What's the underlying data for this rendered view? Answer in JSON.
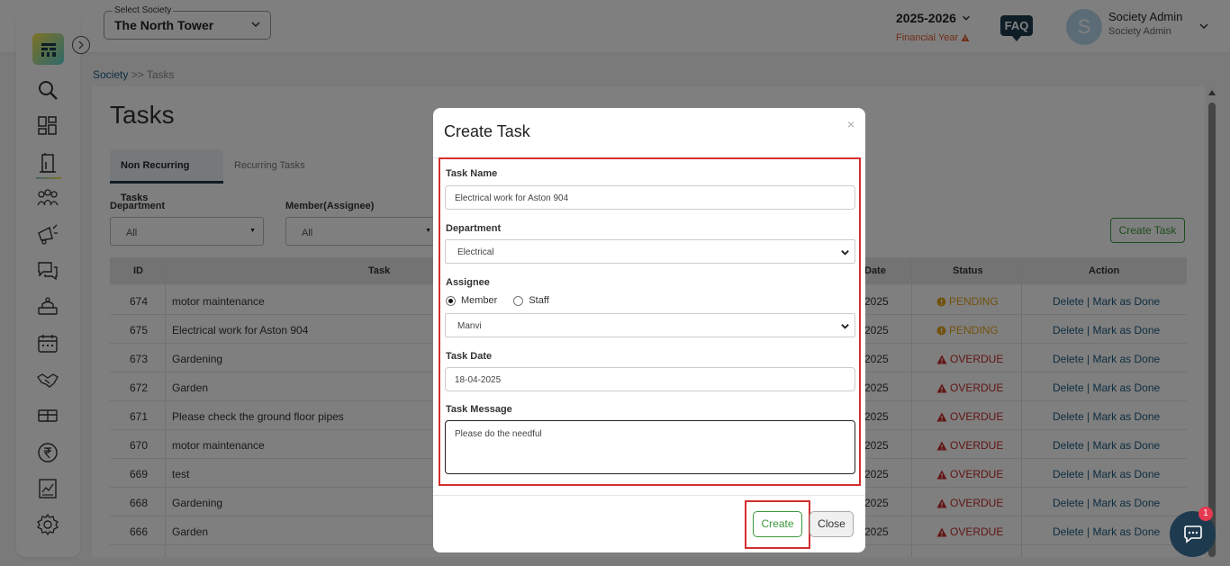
{
  "header": {
    "society_select_label": "Select Society",
    "society_select_value": "The North Tower",
    "financial_year": "2025-2026",
    "financial_year_label": "Financial Year",
    "faq_label": "FAQ",
    "avatar_letter": "S",
    "user_name": "Society Admin",
    "user_role": "Society Admin"
  },
  "breadcrumb": {
    "root": "Society",
    "separator": ">>",
    "current": "Tasks"
  },
  "page": {
    "title": "Tasks",
    "tabs": [
      {
        "label": "Non Recurring Tasks",
        "active": true
      },
      {
        "label": "Recurring Tasks",
        "active": false
      }
    ],
    "filters": {
      "department_label": "Department",
      "department_value": "All",
      "member_label": "Member(Assignee)",
      "member_value": "All"
    },
    "create_task_button": "Create Task",
    "columns": {
      "id": "ID",
      "task": "Task",
      "date": "Date",
      "status": "Status",
      "action": "Action"
    },
    "rows": [
      {
        "id": "674",
        "task": "motor maintenance",
        "date": "2025",
        "status": "PENDING",
        "action": "Delete | Mark as Done"
      },
      {
        "id": "675",
        "task": "Electrical work for Aston 904",
        "date": "2025",
        "status": "PENDING",
        "action": "Delete | Mark as Done"
      },
      {
        "id": "673",
        "task": "Gardening",
        "date": "2025",
        "status": "OVERDUE",
        "action": "Delete | Mark as Done"
      },
      {
        "id": "672",
        "task": "Garden",
        "date": "2025",
        "status": "OVERDUE",
        "action": "Delete | Mark as Done"
      },
      {
        "id": "671",
        "task": "Please check the ground floor pipes",
        "date": "2025",
        "status": "OVERDUE",
        "action": "Delete | Mark as Done"
      },
      {
        "id": "670",
        "task": "motor maintenance",
        "date": "2025",
        "status": "OVERDUE",
        "action": "Delete | Mark as Done"
      },
      {
        "id": "669",
        "task": "test",
        "date": "2025",
        "status": "OVERDUE",
        "action": "Delete | Mark as Done"
      },
      {
        "id": "668",
        "task": "Gardening",
        "date": "2025",
        "status": "OVERDUE",
        "action": "Delete | Mark as Done"
      },
      {
        "id": "666",
        "task": "Garden",
        "date": "2025",
        "status": "OVERDUE",
        "action": "Delete | Mark as Done"
      }
    ]
  },
  "modal": {
    "title": "Create Task",
    "close_symbol": "×",
    "task_name_label": "Task Name",
    "task_name_value": "Electrical work for Aston 904",
    "department_label": "Department",
    "department_value": "Electrical",
    "assignee_label": "Assignee",
    "assignee_option_member": "Member",
    "assignee_option_staff": "Staff",
    "assignee_value": "Manvi",
    "task_date_label": "Task Date",
    "task_date_value": "18-04-2025",
    "task_message_label": "Task Message",
    "task_message_value": "Please do the needful",
    "create_button": "Create",
    "close_button": "Close"
  },
  "chat": {
    "badge_count": "1"
  },
  "colors": {
    "accent_navy": "#1e3a4f",
    "pending": "#e3a51a",
    "overdue": "#c62828",
    "link": "#1c5a80",
    "success_green": "#3a9a3a",
    "highlight_red": "#d32f2f"
  },
  "sidebar_icons": [
    "search-icon",
    "dashboard-icon",
    "building-icon",
    "members-icon",
    "announcement-icon",
    "chat-icon",
    "helpdesk-icon",
    "calendar-icon",
    "handshake-icon",
    "amenities-icon",
    "rupee-icon",
    "reports-icon",
    "settings-icon"
  ]
}
